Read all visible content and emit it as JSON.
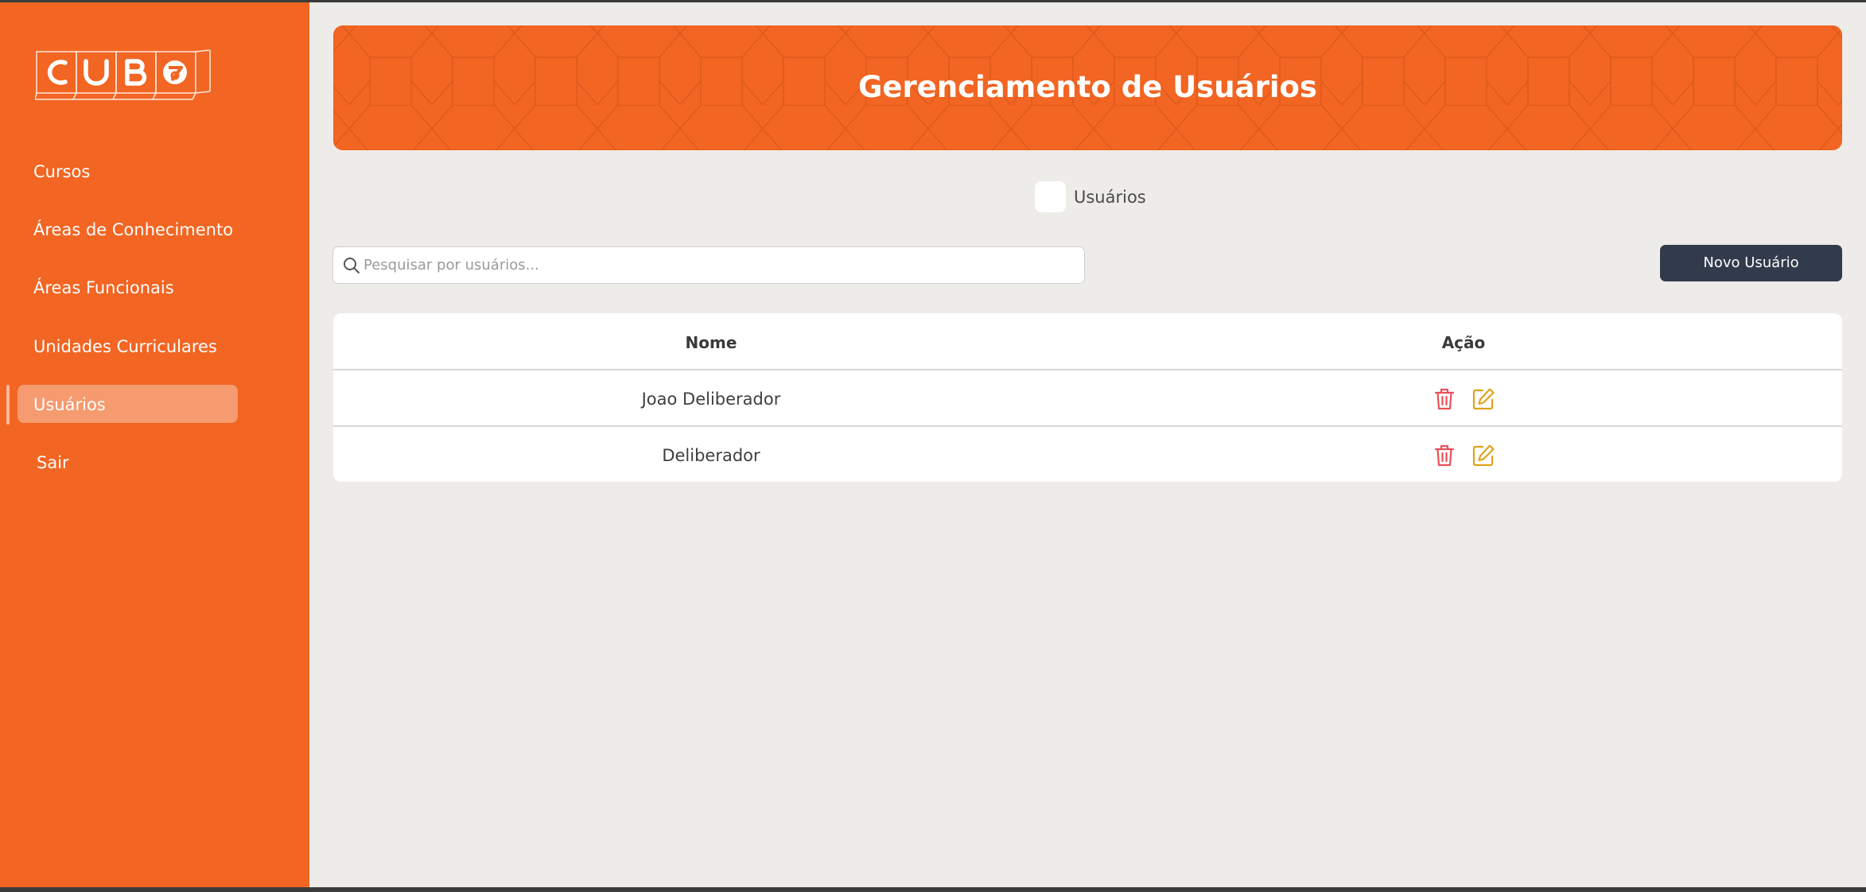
{
  "sidebar": {
    "logo_text": "CUBO",
    "items": [
      {
        "label": "Cursos"
      },
      {
        "label": "Áreas de Conhecimento"
      },
      {
        "label": "Áreas Funcionais"
      },
      {
        "label": "Unidades Curriculares"
      },
      {
        "label": "Usuários",
        "active": true
      },
      {
        "label": "Sair"
      }
    ]
  },
  "header": {
    "title": "Gerenciamento de Usuários"
  },
  "toggle": {
    "label": "Usuários",
    "checked": false
  },
  "search": {
    "placeholder": "Pesquisar por usuários...",
    "value": "",
    "icon": "search-icon"
  },
  "toolbar": {
    "new_user_label": "Novo Usuário"
  },
  "table": {
    "columns": [
      "Nome",
      "Ação"
    ],
    "rows": [
      {
        "name": "Joao Deliberador",
        "actions": [
          "trash-icon",
          "edit-icon"
        ]
      },
      {
        "name": "Deliberador",
        "actions": [
          "trash-icon",
          "edit-icon"
        ]
      }
    ]
  },
  "colors": {
    "brand_orange": "#f26522",
    "background": "#edece8",
    "button_dark": "#323b4b",
    "delete_red": "#e8505b",
    "edit_yellow": "#e0a21a"
  }
}
